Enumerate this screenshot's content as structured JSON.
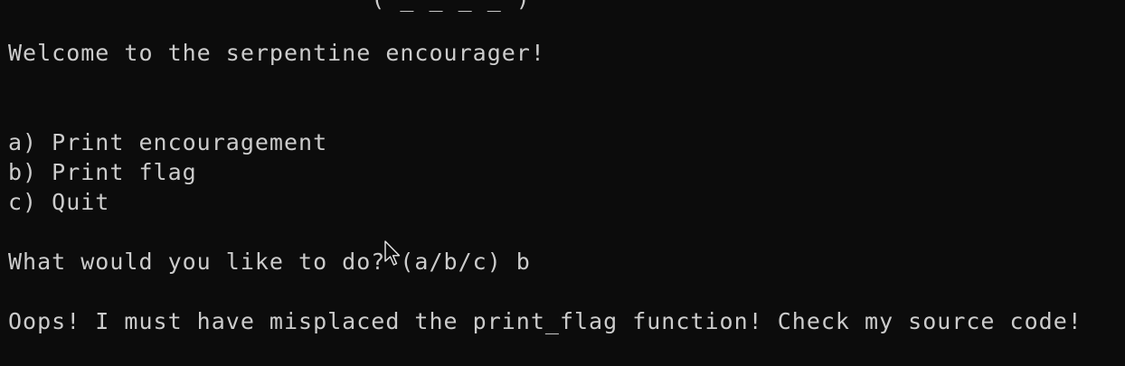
{
  "terminal": {
    "ascii_art_tail": "                         ( _ _ _ _ )",
    "welcome": "Welcome to the serpentine encourager!",
    "menu": [
      "a) Print encouragement",
      "b) Print flag",
      "c) Quit"
    ],
    "prompt": "What would you like to do? (a/b/c) b",
    "response": "Oops! I must have misplaced the print_flag function! Check my source code!"
  }
}
